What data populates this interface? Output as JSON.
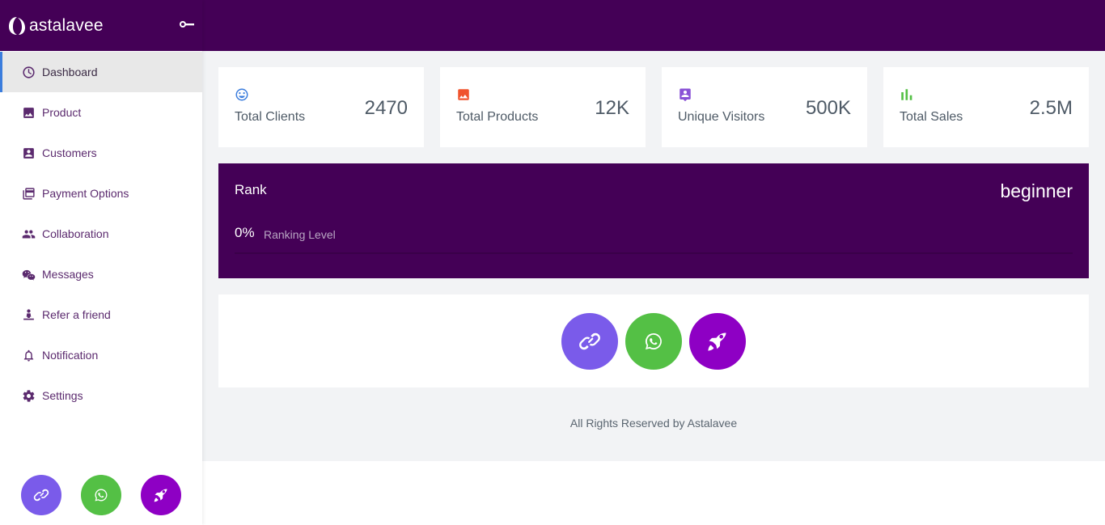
{
  "brand": {
    "name": "astalavee"
  },
  "sidebar": {
    "items": [
      {
        "label": "Dashboard",
        "icon": "dashboard-icon",
        "active": true
      },
      {
        "label": "Product",
        "icon": "image-icon"
      },
      {
        "label": "Customers",
        "icon": "contact-icon"
      },
      {
        "label": "Payment Options",
        "icon": "payment-icon"
      },
      {
        "label": "Collaboration",
        "icon": "people-icon"
      },
      {
        "label": "Messages",
        "icon": "chat-icon"
      },
      {
        "label": "Refer a friend",
        "icon": "refer-icon"
      },
      {
        "label": "Notification",
        "icon": "bell-icon"
      },
      {
        "label": "Settings",
        "icon": "gear-icon"
      }
    ]
  },
  "stats": [
    {
      "label": "Total Clients",
      "value": "2470",
      "icon": "smile-icon",
      "color": "#3b7ddd"
    },
    {
      "label": "Total Products",
      "value": "12K",
      "icon": "image-icon",
      "color": "#f0532d"
    },
    {
      "label": "Unique Visitors",
      "value": "500K",
      "icon": "visitor-icon",
      "color": "#8a52d6"
    },
    {
      "label": "Total Sales",
      "value": "2.5M",
      "icon": "bar-chart-icon",
      "color": "#54c045"
    }
  ],
  "rank": {
    "title": "Rank",
    "level": "beginner",
    "percent": "0%",
    "sublabel": "Ranking Level",
    "progress": 0
  },
  "footer": {
    "text": "All Rights Reserved by Astalavee"
  },
  "colors": {
    "header": "#440056",
    "link_button": "#7a5bea",
    "whatsapp_button": "#54c045",
    "rocket_button": "#8e00c4"
  }
}
